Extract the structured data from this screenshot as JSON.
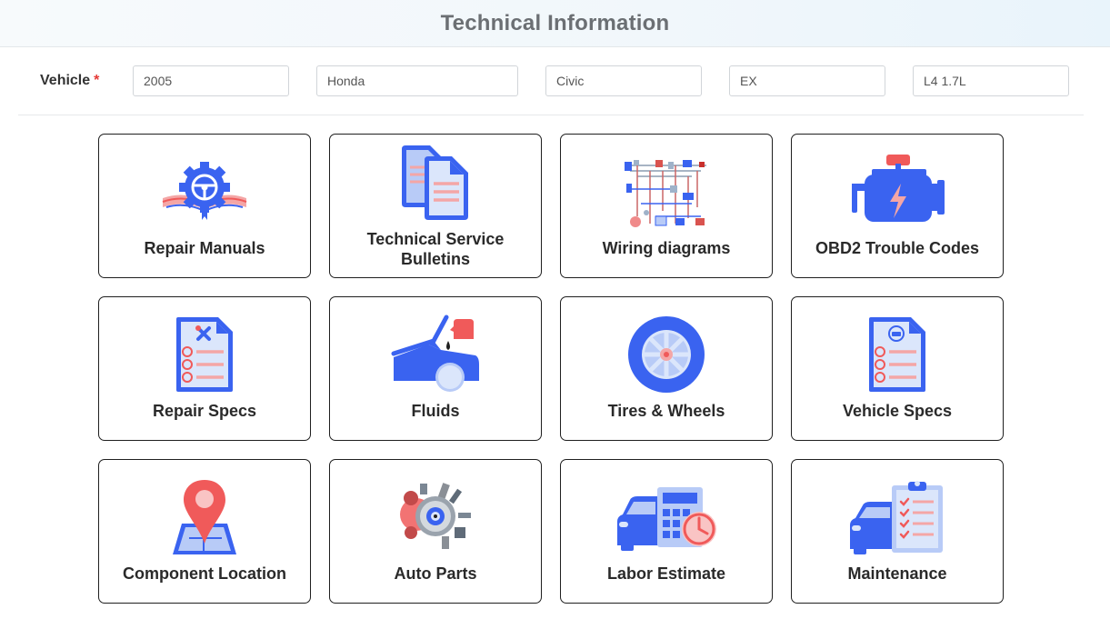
{
  "header": {
    "title": "Technical Information"
  },
  "vehicle": {
    "label": "Vehicle",
    "required_mark": "*",
    "year": "2005",
    "make": "Honda",
    "model": "Civic",
    "trim": "EX",
    "engine": "L4 1.7L"
  },
  "tiles": [
    {
      "label": "Repair Manuals",
      "icon": "repair-manual-icon"
    },
    {
      "label": "Technical Service Bulletins",
      "icon": "documents-icon"
    },
    {
      "label": "Wiring diagrams",
      "icon": "wiring-diagram-icon"
    },
    {
      "label": "OBD2 Trouble Codes",
      "icon": "engine-icon"
    },
    {
      "label": "Repair Specs",
      "icon": "repair-spec-sheet-icon"
    },
    {
      "label": "Fluids",
      "icon": "car-hood-oil-icon"
    },
    {
      "label": "Tires & Wheels",
      "icon": "tire-icon"
    },
    {
      "label": "Vehicle Specs",
      "icon": "vehicle-spec-sheet-icon"
    },
    {
      "label": "Component Location",
      "icon": "map-pin-icon"
    },
    {
      "label": "Auto Parts",
      "icon": "auto-parts-icon"
    },
    {
      "label": "Labor Estimate",
      "icon": "calculator-clock-icon"
    },
    {
      "label": "Maintenance",
      "icon": "checklist-car-icon"
    }
  ],
  "colors": {
    "primary_blue": "#3a63f0",
    "light_blue": "#b8cbf7",
    "accent_red": "#f05a5a",
    "pink": "#f4a6a6"
  }
}
